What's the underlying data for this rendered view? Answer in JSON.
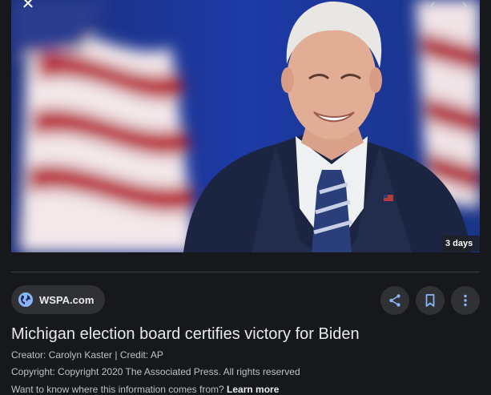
{
  "image": {
    "alt_subject": "Smiling man in navy suit with striped tie in front of American flags",
    "time_badge": "3 days ago"
  },
  "icons": {
    "close": "close-icon",
    "prev": "chevron-left-icon",
    "next": "chevron-right-icon",
    "source": "globe-icon",
    "share": "share-icon",
    "save": "bookmark-icon",
    "more": "more-vert-icon"
  },
  "source": {
    "name": "WSPA.com"
  },
  "article": {
    "title": "Michigan election board certifies victory for Biden",
    "creator_line": "Creator: Carolyn Kaster | Credit: AP",
    "copyright_line": "Copyright: Copyright 2020 The Associated Press. All rights reserved",
    "info_prompt": "Want to know where this information comes from?",
    "learn_more": "Learn more"
  },
  "colors": {
    "background": "#17181b",
    "chip": "#303134",
    "accent_blue": "#8ab4f8"
  }
}
